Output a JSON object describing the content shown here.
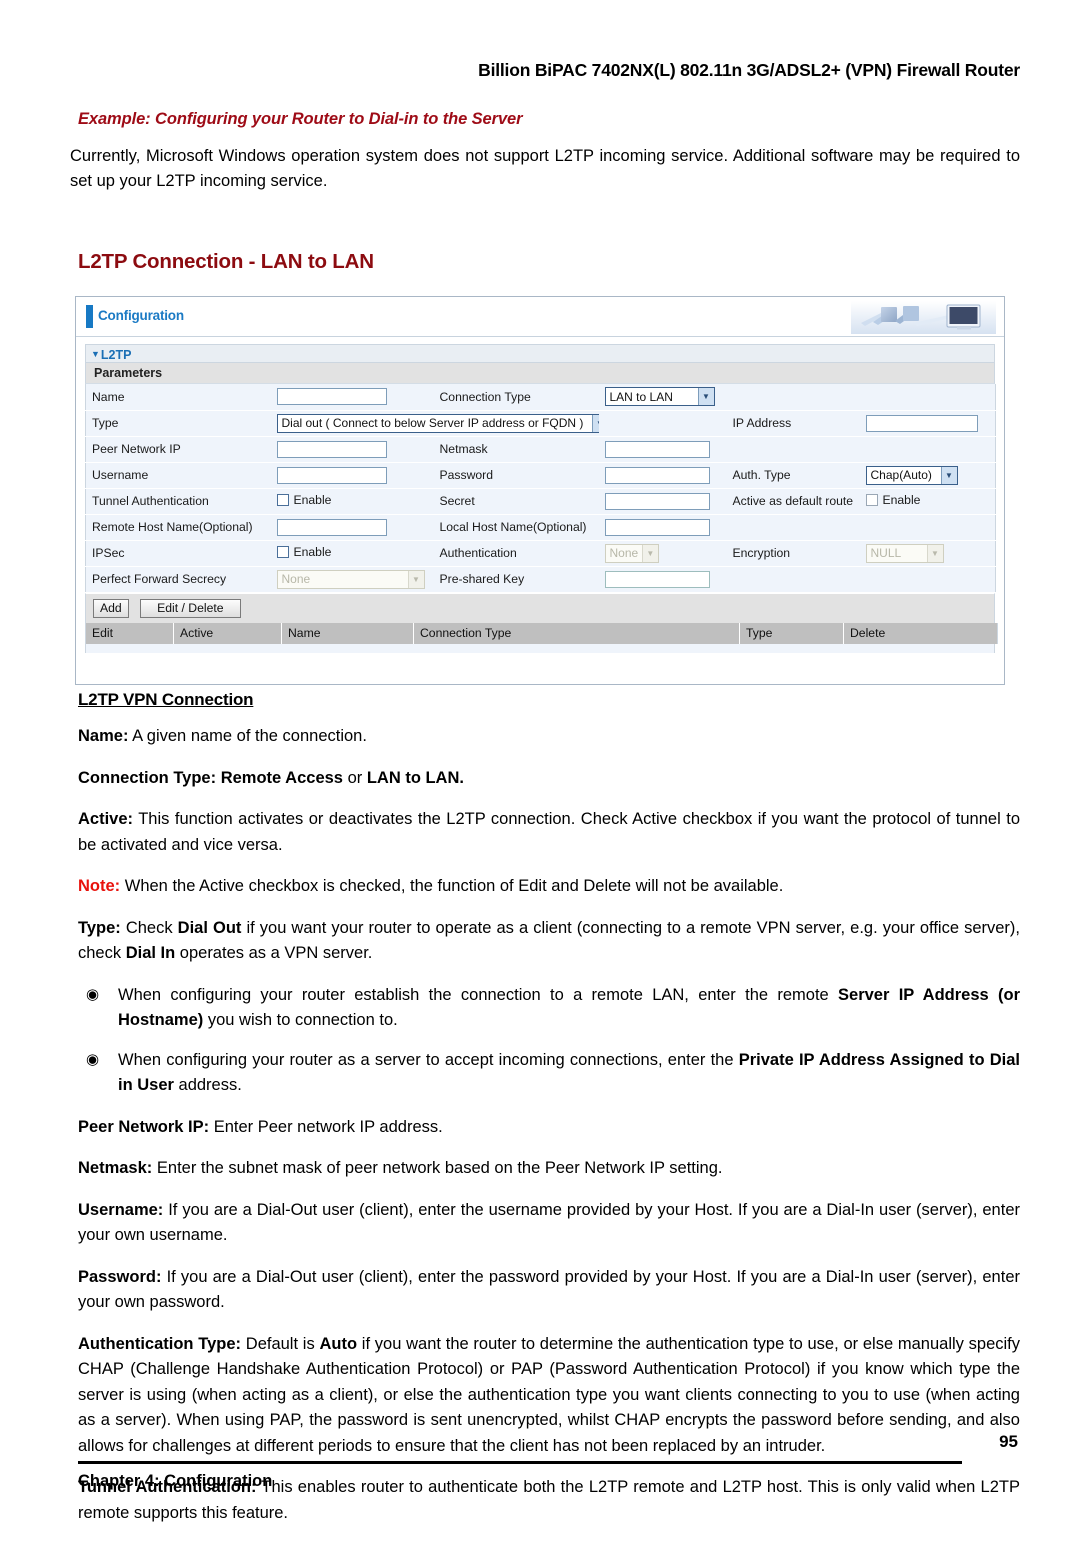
{
  "document": {
    "running_header": "Billion BiPAC 7402NX(L) 802.11n 3G/ADSL2+ (VPN) Firewall Router",
    "example_heading": "Example: Configuring your Router to Dial-in to the Server",
    "intro_paragraph": "Currently, Microsoft Windows operation system does not support L2TP incoming service.   Additional software may be required to set up your L2TP incoming service.",
    "section_title": "L2TP Connection - LAN to LAN",
    "footer": {
      "page_number": "95",
      "chapter": "Chapter 4: Configuration"
    }
  },
  "router_ui": {
    "titlebar": {
      "label": "Configuration",
      "accent_color": "#1779c4",
      "hero_icon": "computers-illustration"
    },
    "panel": {
      "heading": "L2TP",
      "subheading": "Parameters",
      "rows": [
        {
          "label": "Name",
          "control": "textbox",
          "value": "",
          "label2": "Connection Type",
          "control2": "select",
          "value2": "LAN to LAN",
          "label3": "",
          "control3": "none",
          "value3": ""
        },
        {
          "label": "Type",
          "control": "select-wide",
          "value": "Dial out ( Connect to below Server IP address or FQDN )",
          "label2": "",
          "control2": "none",
          "value2": "",
          "label3": "IP Address",
          "control3": "textbox",
          "value3": ""
        },
        {
          "label": "Peer Network IP",
          "control": "textbox",
          "value": "",
          "label2": "Netmask",
          "control2": "textbox",
          "value2": "",
          "label3": "",
          "control3": "none",
          "value3": ""
        },
        {
          "label": "Username",
          "control": "textbox",
          "value": "",
          "label2": "Password",
          "control2": "textbox",
          "value2": "",
          "label3": "Auth. Type",
          "control3": "select",
          "value3": "Chap(Auto)"
        },
        {
          "label": "Tunnel Authentication",
          "control": "checkbox",
          "value": "Enable",
          "label2": "Secret",
          "control2": "textbox",
          "value2": "",
          "label3": "Active as default route",
          "control3": "checkbox",
          "value3": "Enable"
        },
        {
          "label": "Remote Host Name(Optional)",
          "control": "textbox",
          "value": "",
          "label2": "Local Host Name(Optional)",
          "control2": "textbox",
          "value2": "",
          "label3": "",
          "control3": "none",
          "value3": ""
        },
        {
          "label": "IPSec",
          "control": "checkbox",
          "value": "Enable",
          "label2": "Authentication",
          "control2": "select-disabled",
          "value2": "None",
          "label3": "Encryption",
          "control3": "select-disabled",
          "value3": "NULL"
        },
        {
          "label": "Perfect Forward Secrecy",
          "control": "select-disabled",
          "value": "None",
          "label2": "Pre-shared Key",
          "control2": "textbox",
          "value2": "",
          "label3": "",
          "control3": "none",
          "value3": ""
        }
      ],
      "buttons": {
        "add": "Add",
        "edit_delete": "Edit / Delete"
      },
      "list_columns": [
        "Edit",
        "Active",
        "Name",
        "Connection Type",
        "Type",
        "Delete"
      ],
      "list_rows": []
    }
  },
  "content": {
    "sub_head": "L2TP VPN Connection",
    "name_label": "Name:",
    "name_text": " A given name of the connection.",
    "conn_type_label": "Connection Type: Remote Access",
    "conn_type_mid": " or ",
    "conn_type_end": "LAN to LAN.",
    "active_label": "Active:",
    "active_text": " This function activates or deactivates the L2TP connection.   Check Active checkbox if you want the protocol of tunnel to be activated and vice versa.",
    "note_label": "Note:",
    "note_text": " When the Active checkbox is checked, the function of Edit and Delete will not be available.",
    "type_label": "Type:",
    "type_t1": " Check ",
    "type_b1": "Dial Out",
    "type_t2": " if you want your router to operate as a client (connecting to a remote VPN server, e.g. your office server), check ",
    "type_b2": "Dial In",
    "type_t3": " operates as a VPN server.",
    "bullets": [
      {
        "glyph": "◉",
        "t1": "When configuring your router establish the connection to a remote LAN, enter the remote ",
        "b1": "Server IP Address (or Hostname)",
        "t2": " you wish to connection to."
      },
      {
        "glyph": "◉",
        "t1": "When configuring your router as a server to accept incoming connections, enter the ",
        "b1": "Private IP Address Assigned to Dial in User",
        "t2": " address."
      }
    ],
    "peer_label": "Peer Network IP:",
    "peer_text": " Enter Peer network IP address.",
    "netmask_label": "Netmask:",
    "netmask_text": " Enter the subnet mask of peer network based on the Peer Network IP setting.",
    "username_label": "Username:",
    "username_text": " If you are a Dial-Out user (client), enter the username provided by your Host.   If you are a Dial-In user (server), enter your own username.",
    "password_label": "Password:",
    "password_text": " If you are a Dial-Out user (client), enter the password provided by your Host. If you are a Dial-In user (server), enter your own password.",
    "authtype_label": "Authentication Type:",
    "authtype_t1": " Default is ",
    "authtype_b1": "Auto",
    "authtype_t2": " if you want the router to determine the authentication type to use, or else manually specify CHAP (Challenge Handshake Authentication Protocol) or PAP (Password Authentication Protocol) if you know which type the server is using (when acting as a client), or else the authentication type you want clients connecting to you to use (when acting as a server). When using PAP, the password is sent unencrypted, whilst CHAP encrypts the password before sending, and also allows for challenges at different periods to ensure that the client has not been replaced by an intruder.",
    "tunnelauth_label": "Tunnel Authentication:",
    "tunnelauth_text": " This enables router to authenticate both the L2TP remote and L2TP host.   This is only valid when L2TP remote supports this feature."
  }
}
